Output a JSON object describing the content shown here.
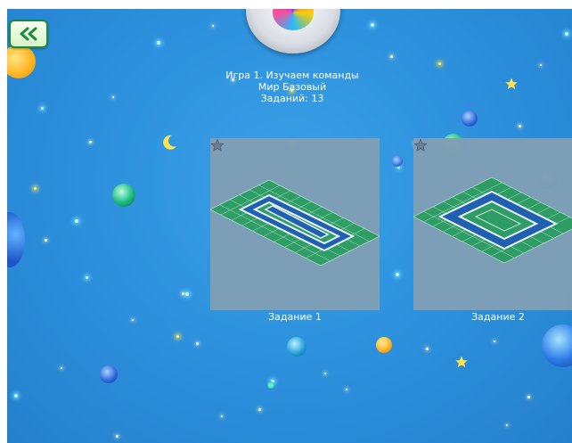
{
  "nav": {
    "back_icon": "double-chevron-left-icon"
  },
  "header": {
    "line1": "Игра 1. Изучаем команды",
    "line2": "Мир Базовый",
    "line3": "Заданий: 13"
  },
  "levels": [
    {
      "label": "Задание 1",
      "star_icon": "star-outline-icon"
    },
    {
      "label": "Задание 2",
      "star_icon": "star-outline-icon"
    }
  ],
  "colors": {
    "background": "#2b8fdc",
    "card": "#7f9fb5",
    "tile_green": "#2e9e62",
    "tile_blue": "#1f5fb0",
    "path_white": "#f2f6fb",
    "back_button_border": "#1a8a3c"
  }
}
